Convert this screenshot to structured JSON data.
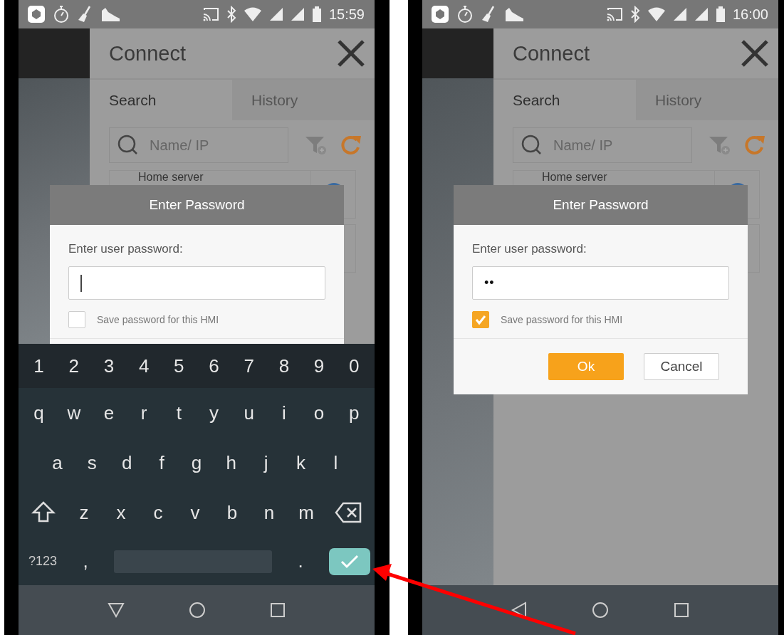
{
  "screens": [
    {
      "status_bar": {
        "time": "15:59"
      },
      "app": {
        "title": "Connect",
        "tabs": [
          {
            "label": "Search",
            "selected": true
          },
          {
            "label": "History",
            "selected": false
          }
        ],
        "search": {
          "placeholder": "Name/ IP"
        },
        "devices": [
          {
            "name": "Home server"
          }
        ]
      },
      "dialog": {
        "title": "Enter Password",
        "prompt": "Enter user password:",
        "password": {
          "focused": true
        },
        "save_password": {
          "label": "Save password for this HMI",
          "checked": false
        }
      },
      "keyboard": {
        "number_row": [
          "1",
          "2",
          "3",
          "4",
          "5",
          "6",
          "7",
          "8",
          "9",
          "0"
        ],
        "letter_rows": [
          [
            "q",
            "w",
            "e",
            "r",
            "t",
            "y",
            "u",
            "i",
            "o",
            "p"
          ],
          [
            "a",
            "s",
            "d",
            "f",
            "g",
            "h",
            "j",
            "k",
            "l"
          ],
          [
            "z",
            "x",
            "c",
            "v",
            "b",
            "n",
            "m"
          ]
        ],
        "symbols_key": "?123",
        "comma_key": ",",
        "period_key": "."
      }
    },
    {
      "status_bar": {
        "time": "16:00"
      },
      "app": {
        "title": "Connect",
        "tabs": [
          {
            "label": "Search",
            "selected": true
          },
          {
            "label": "History",
            "selected": false
          }
        ],
        "search": {
          "placeholder": "Name/ IP"
        },
        "devices": [
          {
            "name": "Home server"
          }
        ]
      },
      "dialog": {
        "title": "Enter Password",
        "prompt": "Enter user password:",
        "password": {
          "value": "••",
          "focused": false
        },
        "save_password": {
          "label": "Save password for this HMI",
          "checked": true
        },
        "buttons": [
          {
            "label": "Ok",
            "kind": "primary"
          },
          {
            "label": "Cancel",
            "kind": "secondary"
          }
        ]
      }
    }
  ]
}
